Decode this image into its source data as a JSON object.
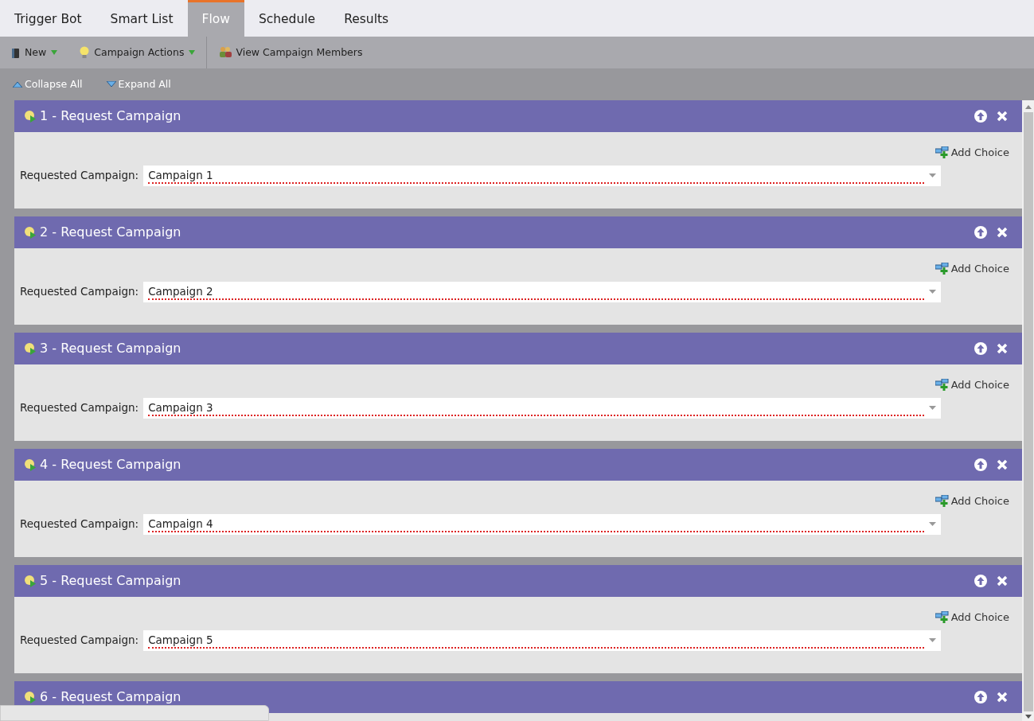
{
  "tabs": [
    {
      "label": "Trigger Bot",
      "selected": false
    },
    {
      "label": "Smart List",
      "selected": false
    },
    {
      "label": "Flow",
      "selected": true
    },
    {
      "label": "Schedule",
      "selected": false
    },
    {
      "label": "Results",
      "selected": false
    }
  ],
  "toolbar": [
    {
      "kind": "new",
      "label": "New",
      "dropdown": true
    },
    {
      "kind": "actions",
      "label": "Campaign Actions",
      "dropdown": true
    },
    {
      "kind": "members",
      "label": "View Campaign Members",
      "dropdown": false
    }
  ],
  "subtoolbar": [
    {
      "kind": "collapse",
      "label": "Collapse All"
    },
    {
      "kind": "expand",
      "label": "Expand All"
    }
  ],
  "steps": [
    {
      "title": "1 - Request Campaign",
      "add_choice": "Add Choice",
      "field_label": "Requested Campaign:",
      "value": "Campaign 1"
    },
    {
      "title": "2 - Request Campaign",
      "add_choice": "Add Choice",
      "field_label": "Requested Campaign:",
      "value": "Campaign 2"
    },
    {
      "title": "3 - Request Campaign",
      "add_choice": "Add Choice",
      "field_label": "Requested Campaign:",
      "value": "Campaign 3"
    },
    {
      "title": "4 - Request Campaign",
      "add_choice": "Add Choice",
      "field_label": "Requested Campaign:",
      "value": "Campaign 4"
    },
    {
      "title": "5 - Request Campaign",
      "add_choice": "Add Choice",
      "field_label": "Requested Campaign:",
      "value": "Campaign 5"
    },
    {
      "title": "6 - Request Campaign"
    }
  ]
}
